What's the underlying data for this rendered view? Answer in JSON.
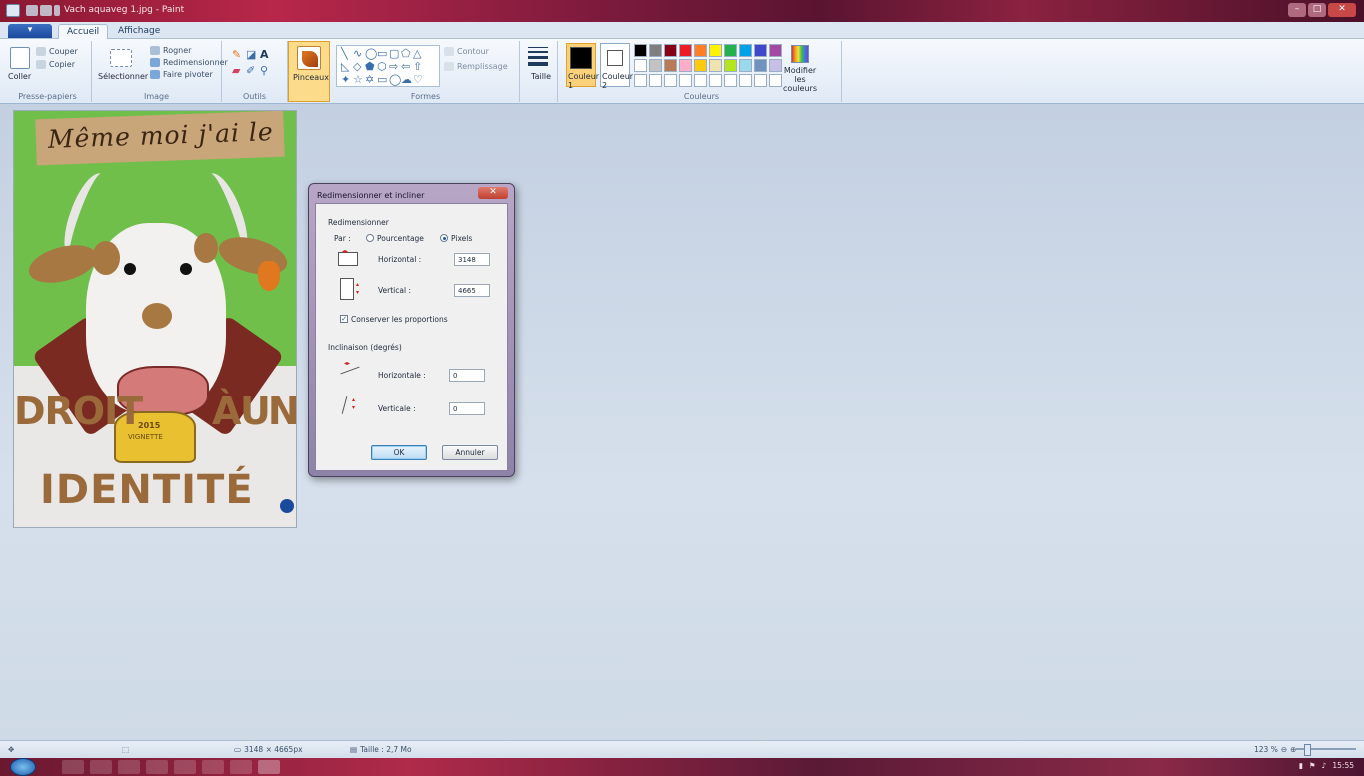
{
  "window": {
    "title": "Vach aquaveg 1.jpg - Paint",
    "win_min": "–",
    "win_max": "□",
    "win_close": "✕"
  },
  "ribbon_tabs": [
    {
      "label": "Accueil"
    },
    {
      "label": "Affichage"
    }
  ],
  "ribbon": {
    "clipboard": {
      "paste": "Coller",
      "cut": "Couper",
      "copy": "Copier",
      "label": "Presse-papiers"
    },
    "image": {
      "select": "Sélectionner",
      "crop": "Rogner",
      "resize": "Redimensionner",
      "rotate": "Faire pivoter",
      "label": "Image"
    },
    "tools": {
      "label": "Outils"
    },
    "brushes": {
      "label": "Pinceaux"
    },
    "shapes": {
      "outline": "Contour",
      "fill": "Remplissage",
      "label": "Formes"
    },
    "size": {
      "label": "Taille"
    },
    "colors": {
      "color1": "Couleur 1",
      "color2": "Couleur 2",
      "edit": "Modifier les couleurs",
      "label": "Couleurs",
      "color1_value": "#000000",
      "color2_value": "#ffffff",
      "palette": [
        "#000000",
        "#7f7f7f",
        "#880015",
        "#ed1c24",
        "#ff7f27",
        "#fff200",
        "#22b14c",
        "#00a2e8",
        "#3f48cc",
        "#a349a4",
        "#ffffff",
        "#c3c3c3",
        "#b97a57",
        "#ffaec9",
        "#ffc90e",
        "#efe4b0",
        "#b5e61d",
        "#99d9ea",
        "#7092be",
        "#c8bfe7",
        "#ffffff",
        "#ffffff",
        "#ffffff",
        "#ffffff",
        "#ffffff",
        "#ffffff",
        "#ffffff",
        "#ffffff",
        "#ffffff",
        "#ffffff"
      ]
    }
  },
  "picture": {
    "banner_text": "Même moi j'ai le",
    "words_left": "DROIT",
    "words_center": "À",
    "words_right": "UNE",
    "bottom_word": "IDENTITÉ",
    "bell_year": "2015",
    "bell_text": "VIGNETTE"
  },
  "dialog": {
    "title": "Redimensionner et incliner",
    "close": "✕",
    "resize_section": "Redimensionner",
    "by_label": "Par :",
    "percent_label": "Pourcentage",
    "pixels_label": "Pixels",
    "horizontal_label": "Horizontal :",
    "horizontal_value": "3148",
    "vertical_label": "Vertical :",
    "vertical_value": "4665",
    "keep_ratio_label": "Conserver les proportions",
    "skew_section": "Inclinaison (degrés)",
    "skew_horizontal_label": "Horizontale :",
    "skew_horizontal_value": "0",
    "skew_vertical_label": "Verticale :",
    "skew_vertical_value": "0",
    "ok": "OK",
    "cancel": "Annuler"
  },
  "status": {
    "move_icon": "✥",
    "dimensions": "3148 × 4665px",
    "size": "Taille : 2,7 Mo",
    "zoom": "123 %"
  },
  "taskbar": {
    "time": "15:55"
  }
}
